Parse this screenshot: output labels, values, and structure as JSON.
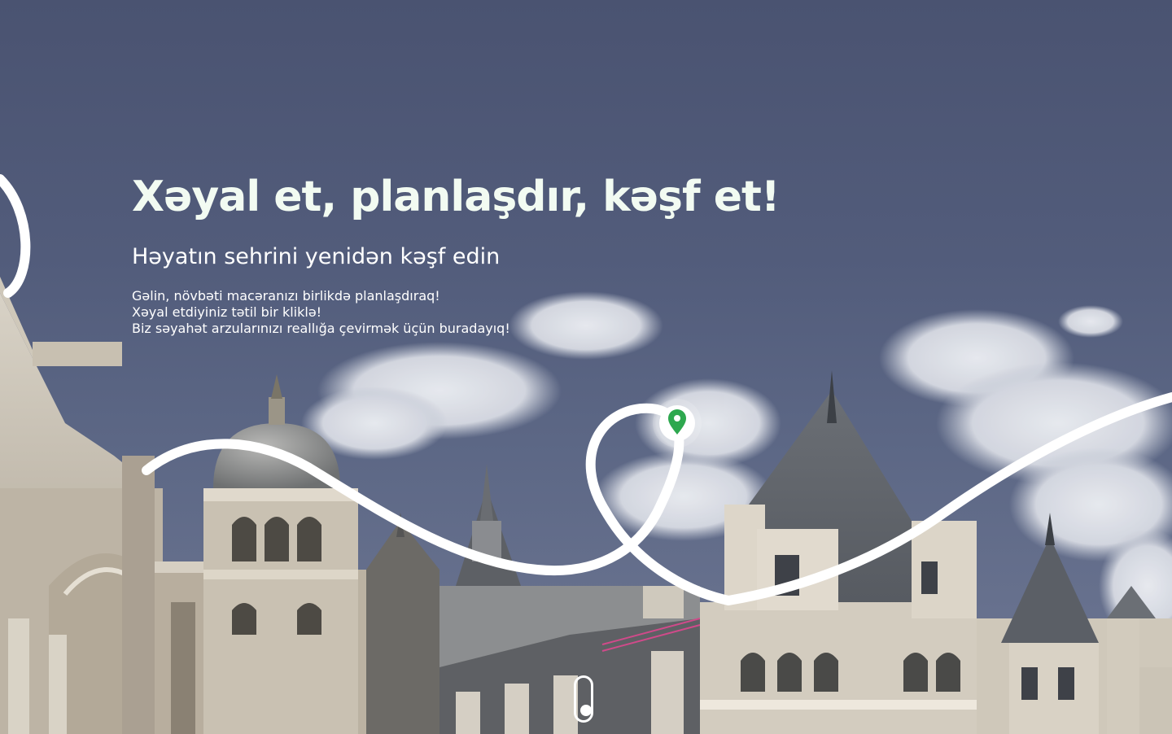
{
  "hero": {
    "headline": "Xəyal et, planlaşdır, kəşf et!",
    "subheadline": "Həyatın sehrini yenidən kəşf edin",
    "body_lines": [
      "Gəlin, növbəti macəranızı birlikdə planlaşdıraq!",
      "Xəyal etdiyiniz tətil bir kliklə!",
      "Biz səyahət arzularınızı reallığa çevirmək üçün buradayıq!"
    ]
  },
  "icons": {
    "pin": "map-pin-icon",
    "scroll": "mouse-scroll-icon"
  },
  "colors": {
    "sky": "#525c7b",
    "headline": "#f2fbf2",
    "pin_accent": "#2ea84f",
    "route": "#ffffff"
  }
}
